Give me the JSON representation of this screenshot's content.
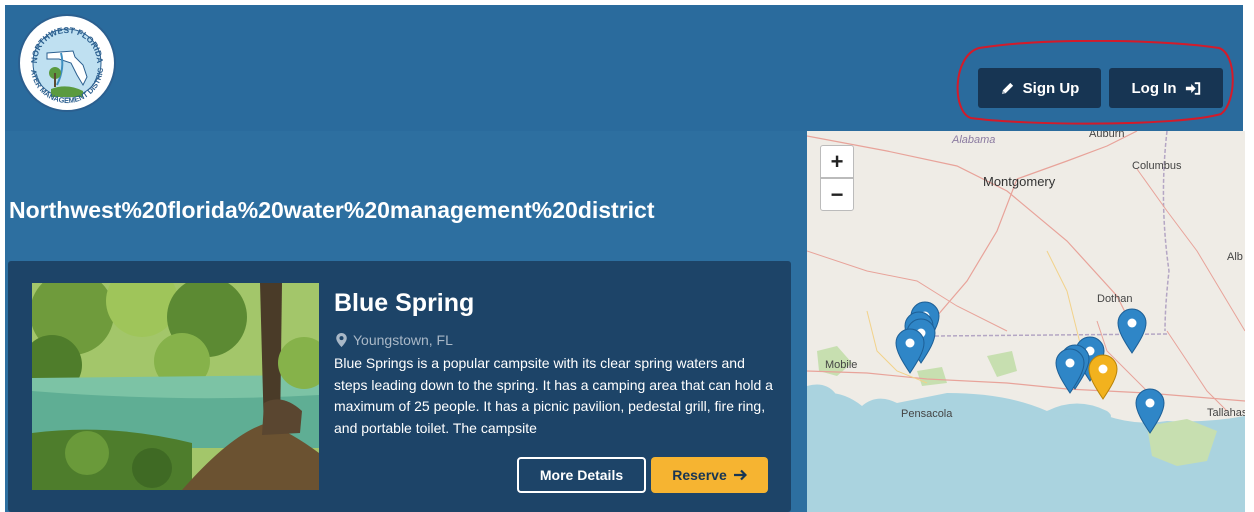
{
  "header": {
    "logo_text_top": "NORTHWEST FLORIDA",
    "logo_text_bottom": "WATER MANAGEMENT DISTRICT",
    "signup_label": "Sign Up",
    "login_label": "Log In"
  },
  "page": {
    "title": "Northwest%20florida%20water%20management%20district"
  },
  "card": {
    "name": "Blue Spring",
    "location": "Youngstown, FL",
    "description": "Blue Springs is a popular campsite with its clear spring waters and steps leading down to the spring. It has a camping area that can hold a maximum of 25 people. It has a picnic pavilion, pedestal grill, fire ring, and portable toilet. The campsite",
    "more_details_label": "More Details",
    "reserve_label": "Reserve"
  },
  "map": {
    "zoom_in": "+",
    "zoom_out": "−",
    "places": {
      "alabama": "Alabama",
      "auburn": "Auburn",
      "montgomery": "Montgomery",
      "columbus": "Columbus",
      "alb": "Alb",
      "dothan": "Dothan",
      "mobile": "Mobile",
      "pensacola": "Pensacola",
      "tallahassee": "Tallahas"
    },
    "marker_colors": {
      "default": "#2f86c7",
      "selected": "#f2b21e"
    }
  },
  "colors": {
    "header_bg": "#2a6b9d",
    "content_bg": "#2d6fa0",
    "card_bg": "#1d4468",
    "button_dark": "#173553",
    "accent": "#f6b431",
    "annotation": "#d31b2a"
  }
}
